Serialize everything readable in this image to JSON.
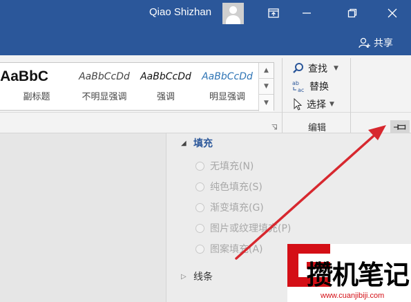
{
  "titlebar": {
    "user_name": "Qiao Shizhan",
    "share_label": "共享",
    "bg_color": "#2b579a"
  },
  "ribbon": {
    "styles": [
      {
        "preview": "AaBbC",
        "name": "副标题"
      },
      {
        "preview": "AaBbCcDd",
        "name": "不明显强调"
      },
      {
        "preview": "AaBbCcDd",
        "name": "强调"
      },
      {
        "preview": "AaBbCcDd",
        "name": "明显强调"
      }
    ],
    "editing": {
      "find": "查找",
      "replace": "替换",
      "select": "选择",
      "group_label": "编辑"
    }
  },
  "pane": {
    "fill_section": "填充",
    "fill_options": [
      "无填充(N)",
      "纯色填充(S)",
      "渐变填充(G)",
      "图片或纹理填充(P)",
      "图案填充(A)"
    ],
    "line_section": "线条"
  },
  "watermark": {
    "text": "攒机笔记",
    "url": "www.cuanjibiji.com"
  },
  "colors": {
    "accent": "#2b579a",
    "arrow": "#d7282f",
    "watermark_red": "#d40f16"
  }
}
